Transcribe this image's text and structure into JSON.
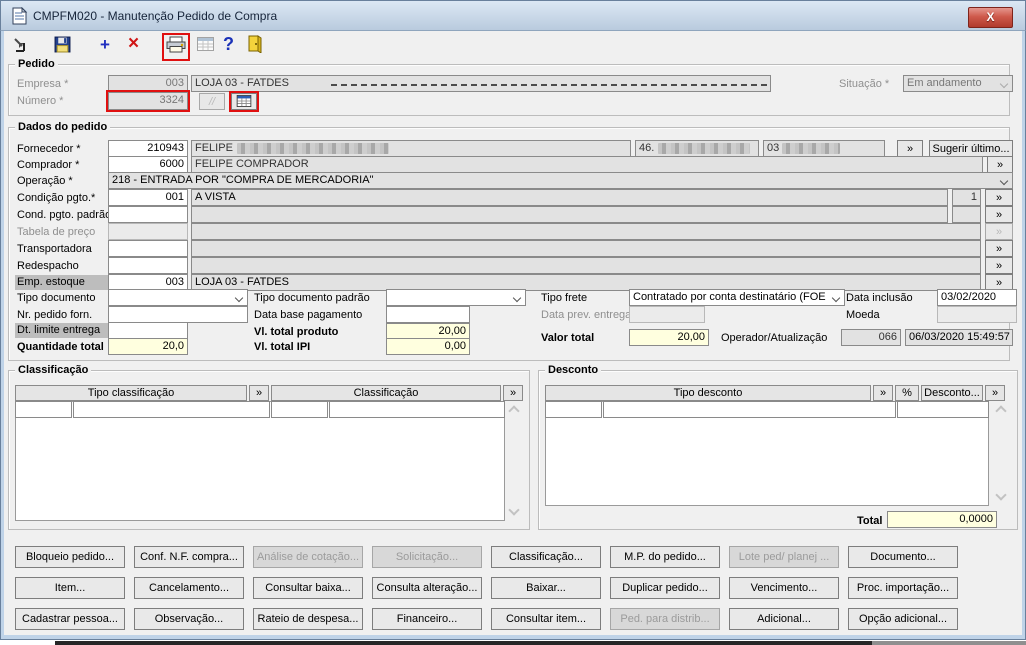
{
  "window": {
    "title": "CMPFM020 - Manutenção Pedido de Compra",
    "close_glyph": "X"
  },
  "toolbar": {
    "plus_glyph": "+",
    "delete_glyph": "×",
    "help_glyph": "?",
    "edit_glyph": "//"
  },
  "glyphs": {
    "lookup": "»"
  },
  "pedido": {
    "title": "Pedido",
    "empresa_label": "Empresa *",
    "empresa_code": "003",
    "empresa_name": "LOJA 03 - FATDES",
    "numero_label": "Número *",
    "numero_value": "3324",
    "situacao_label": "Situação *",
    "situacao_value": "Em andamento"
  },
  "dados": {
    "title": "Dados do pedido",
    "fornecedor_label": "Fornecedor *",
    "fornecedor_code": "210943",
    "fornecedor_name": "FELIPE",
    "fornecedor_cnpj": "46.",
    "fornecedor_loja": "03",
    "sugerir_label": "Sugerir último...",
    "comprador_label": "Comprador *",
    "comprador_code": "6000",
    "comprador_name": "FELIPE COMPRADOR",
    "operacao_label": "Operação *",
    "operacao_value": "218 - ENTRADA POR \"COMPRA DE MERCADORIA\"",
    "condicao_label": "Condição pgto.*",
    "condicao_code": "001",
    "condicao_desc": "A VISTA",
    "condicao_parcela": "1",
    "cond_padrao_label": "Cond. pgto. padrão",
    "tabela_label": "Tabela de preço",
    "transportadora_label": "Transportadora",
    "redespacho_label": "Redespacho",
    "emp_estoque_label": "Emp. estoque",
    "emp_estoque_code": "003",
    "emp_estoque_desc": "LOJA 03 - FATDES",
    "tipo_documento_label": "Tipo documento",
    "tipo_doc_padrao_label": "Tipo documento padrão",
    "tipo_frete_label": "Tipo frete",
    "tipo_frete_value": "Contratado por conta destinatário (FOE",
    "data_inclusao_label": "Data inclusão",
    "data_inclusao_value": "03/02/2020",
    "nr_pedido_label": "Nr. pedido forn.",
    "data_base_label": "Data base pagamento",
    "data_prev_label": "Data prev. entrega",
    "moeda_label": "Moeda",
    "dt_limite_label": "Dt. limite entrega",
    "vl_produto_label": "Vl. total produto",
    "vl_produto_value": "20,00",
    "quantidade_label": "Quantidade total",
    "quantidade_value": "20,0",
    "vl_ipi_label": "Vl. total IPI",
    "vl_ipi_value": "0,00",
    "valor_total_label": "Valor total",
    "valor_total_value": "20,00",
    "operador_label": "Operador/Atualização",
    "operador_code": "066",
    "operador_datetime": "06/03/2020 15:49:57"
  },
  "classificacao": {
    "title": "Classificação",
    "col_tipo": "Tipo classificação",
    "col_class": "Classificação"
  },
  "desconto": {
    "title": "Desconto",
    "col_tipo": "Tipo desconto",
    "col_pct": "%",
    "col_valor": "Desconto...",
    "total_label": "Total",
    "total_value": "0,0000"
  },
  "buttons": [
    "Bloqueio pedido...",
    "Conf. N.F. compra...",
    "Análise de cotação...",
    "Solicitação...",
    "Classificação...",
    "M.P. do pedido...",
    "Lote ped/ planej ...",
    "Documento...",
    "Item...",
    "Cancelamento...",
    "Consultar baixa...",
    "Consulta alteração...",
    "Baixar...",
    "Duplicar pedido...",
    "Vencimento...",
    "Proc. importação...",
    "Cadastrar pessoa...",
    "Observação...",
    "Rateio de despesa...",
    "Financeiro...",
    "Consultar item...",
    "Ped. para distrib...",
    "Adicional...",
    "Opção adicional..."
  ]
}
